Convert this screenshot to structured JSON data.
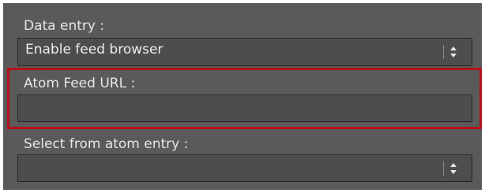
{
  "data_entry": {
    "label": "Data entry :",
    "value": "Enable feed browser"
  },
  "atom_feed_url": {
    "label": "Atom Feed URL :",
    "value": ""
  },
  "select_atom_entry": {
    "label": "Select from atom entry :",
    "value": ""
  },
  "colors": {
    "panel": "#5a5a5a",
    "field": "#4d4d4d",
    "text": "#e6e6e6",
    "highlight": "#b5121b"
  },
  "icons": {
    "dropdown": "up-down-arrows-icon"
  }
}
